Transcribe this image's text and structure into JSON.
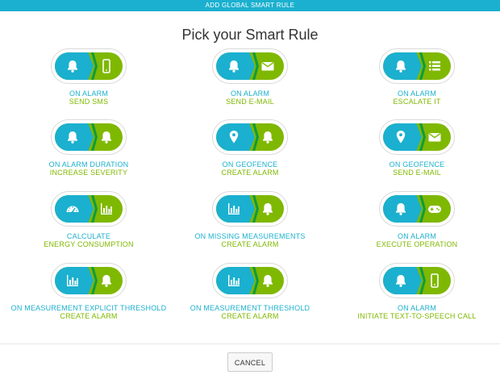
{
  "dialog": {
    "title": "ADD GLOBAL SMART RULE",
    "heading": "Pick your Smart Rule",
    "cancel_label": "CANCEL"
  },
  "rules": [
    {
      "line1": "ON ALARM",
      "line2": "SEND SMS",
      "left_icon": "bell-icon",
      "right_icon": "phone-icon"
    },
    {
      "line1": "ON ALARM",
      "line2": "SEND E-MAIL",
      "left_icon": "bell-icon",
      "right_icon": "envelope-icon"
    },
    {
      "line1": "ON ALARM",
      "line2": "ESCALATE IT",
      "left_icon": "bell-icon",
      "right_icon": "list-icon"
    },
    {
      "line1": "ON ALARM DURATION",
      "line2": "INCREASE SEVERITY",
      "left_icon": "bell-icon",
      "right_icon": "bell-icon"
    },
    {
      "line1": "ON GEOFENCE",
      "line2": "CREATE ALARM",
      "left_icon": "map-pin-icon",
      "right_icon": "bell-icon"
    },
    {
      "line1": "ON GEOFENCE",
      "line2": "SEND E-MAIL",
      "left_icon": "map-pin-icon",
      "right_icon": "envelope-icon"
    },
    {
      "line1": "CALCULATE",
      "line2": "ENERGY CONSUMPTION",
      "left_icon": "gauge-icon",
      "right_icon": "bar-chart-icon"
    },
    {
      "line1": "ON MISSING MEASUREMENTS",
      "line2": "CREATE ALARM",
      "left_icon": "bar-chart-icon",
      "right_icon": "bell-icon"
    },
    {
      "line1": "ON ALARM",
      "line2": "EXECUTE OPERATION",
      "left_icon": "bell-icon",
      "right_icon": "gamepad-icon"
    },
    {
      "line1": "ON MEASUREMENT EXPLICIT THRESHOLD",
      "line2": "CREATE ALARM",
      "left_icon": "bar-chart-icon",
      "right_icon": "bell-icon"
    },
    {
      "line1": "ON MEASUREMENT THRESHOLD",
      "line2": "CREATE ALARM",
      "left_icon": "bar-chart-icon",
      "right_icon": "bell-icon"
    },
    {
      "line1": "ON ALARM",
      "line2": "INITIATE TEXT-TO-SPEECH CALL",
      "left_icon": "bell-icon",
      "right_icon": "phone-icon"
    }
  ],
  "colors": {
    "accent_blue": "#1bb0cf",
    "accent_green": "#7fb800",
    "chevron_green": "#0f9b3f"
  }
}
